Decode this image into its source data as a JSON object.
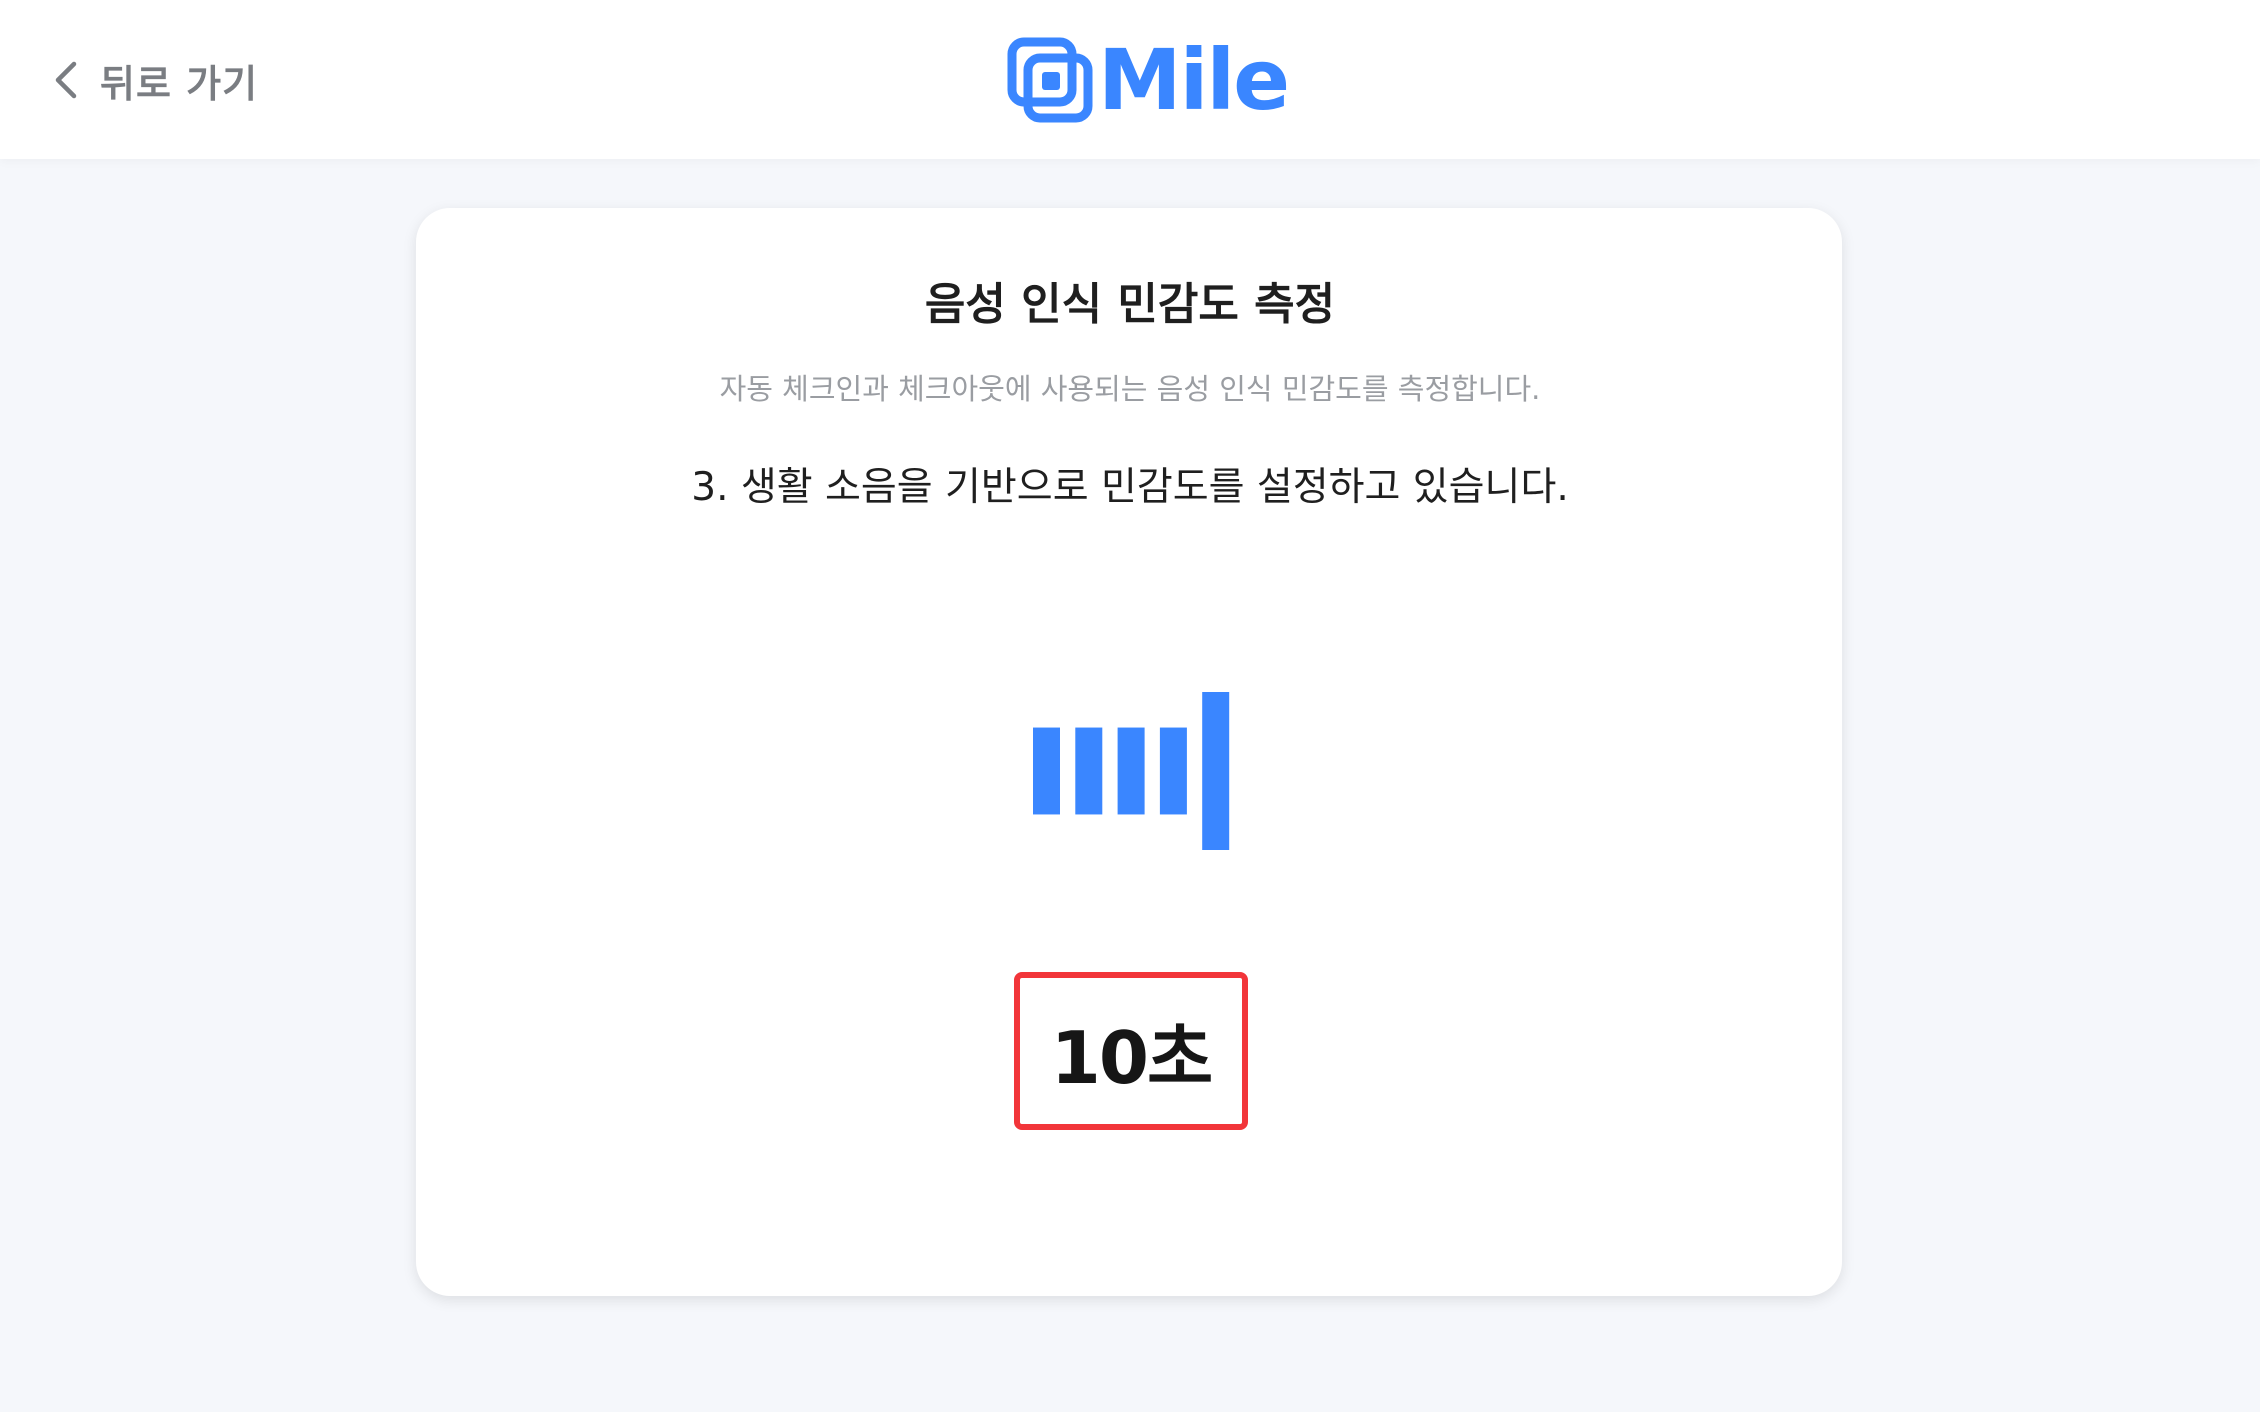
{
  "header": {
    "back_label": "뒤로 가기",
    "logo_text": "Mile",
    "brand_color": "#3a86ff"
  },
  "card": {
    "title": "음성 인식 민감도 측정",
    "subtitle": "자동 체크인과 체크아웃에 사용되는 음성 인식 민감도를 측정합니다.",
    "step": "3. 생활 소음을 기반으로 민감도를 설정하고 있습니다.",
    "countdown": "10초",
    "level_meter": {
      "bars": 5,
      "levels": [
        0.55,
        0.55,
        0.55,
        0.55,
        1.0
      ],
      "color": "#3a86ff"
    },
    "highlight_color": "#f2353a"
  }
}
